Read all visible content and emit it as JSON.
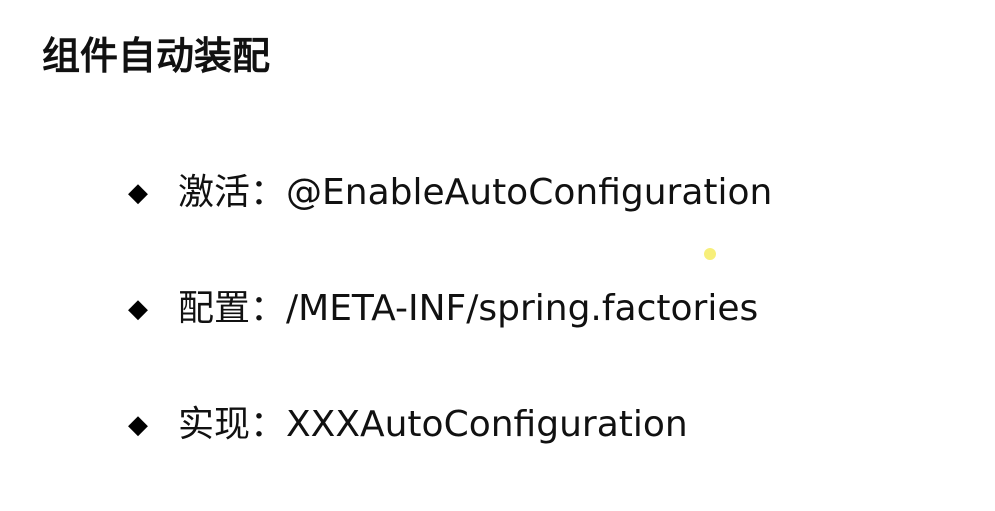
{
  "slide": {
    "title": "组件自动装配",
    "bullet_marker": "◆",
    "bullets": [
      {
        "text": "激活：@EnableAutoConfiguration"
      },
      {
        "text": "配置：/META-INF/spring.factories"
      },
      {
        "text": "实现：XXXAutoConfiguration"
      }
    ],
    "colors": {
      "text": "#111111",
      "pointer_dot": "#f7ef7a"
    }
  }
}
